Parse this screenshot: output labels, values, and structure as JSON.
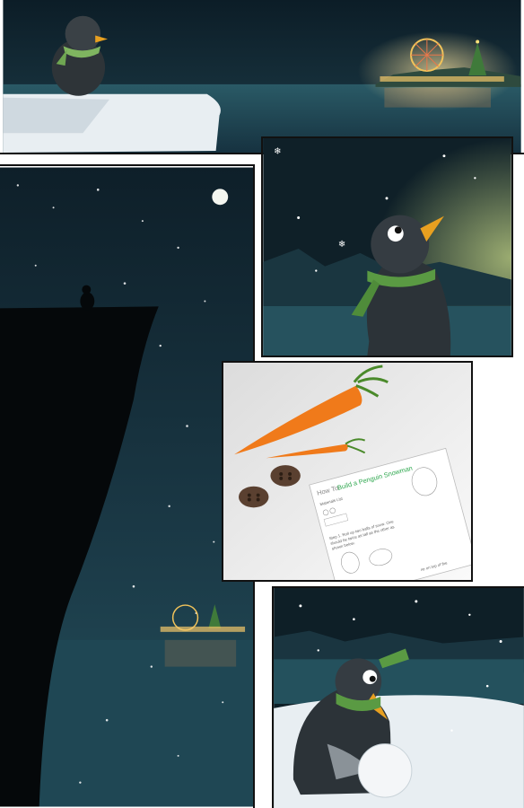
{
  "page": {
    "background": "#ffffff",
    "panel_border": "#111111"
  },
  "panels": [
    {
      "id": "p1",
      "scene": "penguin-on-ice-floe-watching-carnival"
    },
    {
      "id": "p2",
      "scene": "penguin-on-cliff-under-moon"
    },
    {
      "id": "p3",
      "scene": "penguin-looking-up-at-snow"
    },
    {
      "id": "p4",
      "scene": "snowman-supplies-and-instructions"
    },
    {
      "id": "p5",
      "scene": "penguin-rolling-snowball"
    }
  ],
  "handout": {
    "title_prefix": "How To:",
    "title_main": "Build a Penguin Snowman",
    "materials_heading": "Materials List",
    "step1_line1": "Step 1. Roll up two balls of snow. One",
    "step1_line2": "should be twice as tall as the other as",
    "step1_line3": "shown below.",
    "step2_fragment": "ne on top of the"
  },
  "colors": {
    "night_sky": "#0f2430",
    "sea": "#1e4a57",
    "snow": "#e8eef2",
    "scarf_green": "#5a9a43",
    "beak_orange": "#e8a020",
    "carrot_orange": "#f07a1a",
    "button_brown": "#5a4030",
    "accent_green": "#2fa84f"
  }
}
